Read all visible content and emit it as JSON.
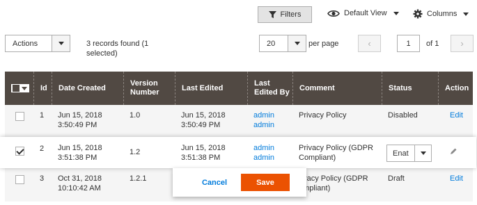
{
  "toolbar": {
    "filters_label": "Filters",
    "view_label": "Default View",
    "columns_label": "Columns"
  },
  "actions": {
    "label": "Actions",
    "records_text": "3 records found (1 selected)"
  },
  "pagination": {
    "per_page_value": "20",
    "per_page_label": "per page",
    "current_page": "1",
    "total_label": "of 1",
    "prev_symbol": "‹",
    "next_symbol": "›"
  },
  "columns": [
    "Id",
    "Date Created",
    "Version Number",
    "Last Edited",
    "Last Edited By",
    "Comment",
    "Status",
    "Action"
  ],
  "rows": [
    {
      "id": "1",
      "date_created": [
        "Jun 15, 2018",
        "3:50:49 PM"
      ],
      "version": "1.0",
      "last_edited": [
        "Jun 15, 2018",
        "3:50:49 PM"
      ],
      "edited_by": [
        "admin",
        "admin"
      ],
      "comment": [
        "Privacy Policy"
      ],
      "status": "Disabled",
      "action": "Edit",
      "checked": false
    },
    {
      "id": "2",
      "date_created": [
        "Jun 15, 2018",
        "3:51:38 PM"
      ],
      "version": "1.2",
      "last_edited": [
        "Jun 15, 2018",
        "3:51:38 PM"
      ],
      "edited_by": [
        "admin",
        "admin"
      ],
      "comment": [
        "Privacy Policy (GDPR",
        "Compliant)"
      ],
      "status": "Enat",
      "action": "",
      "checked": true
    },
    {
      "id": "3",
      "date_created": [
        "Oct 31, 2018",
        "10:10:42 AM"
      ],
      "version": "1.2.1",
      "last_edited": [
        "",
        ""
      ],
      "edited_by": [
        "",
        ""
      ],
      "comment": [
        "rivacy Policy (GDPR",
        "ompliant)"
      ],
      "status": "Draft",
      "action": "Edit",
      "checked": false
    }
  ],
  "inline_edit": {
    "cancel_label": "Cancel",
    "save_label": "Save"
  },
  "colors": {
    "header_bg": "#514943",
    "link": "#007bdb",
    "save_bg": "#eb5202"
  }
}
